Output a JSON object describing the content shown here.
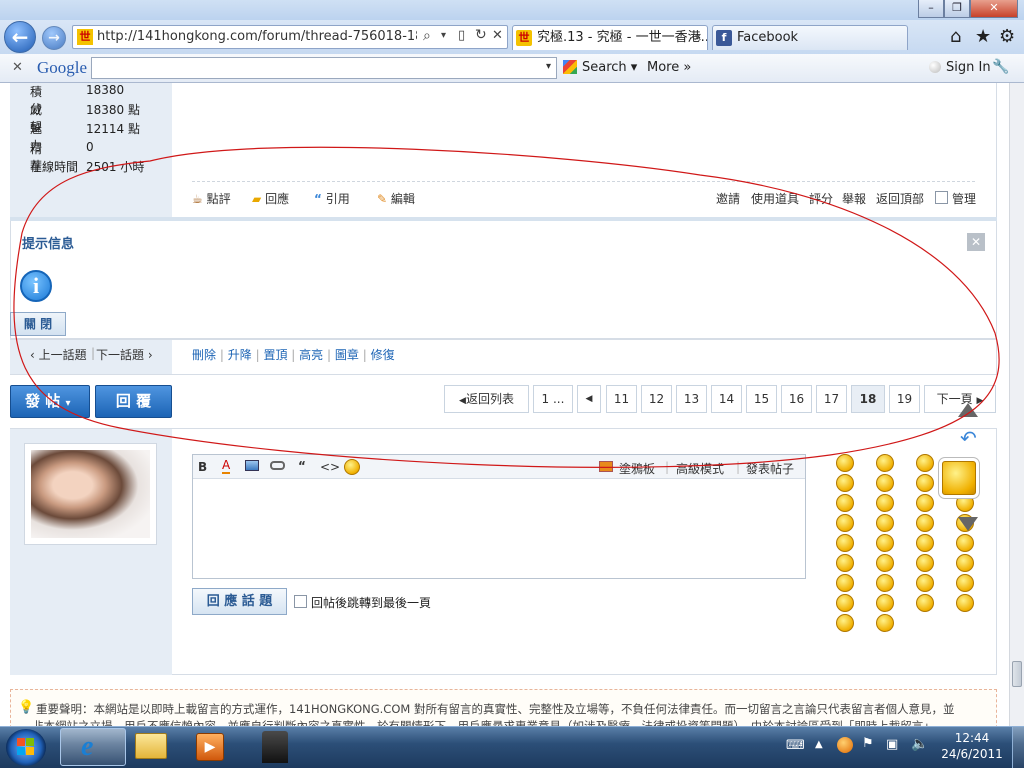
{
  "browser": {
    "url": "http://141hongkong.com/forum/thread-756018-18-1.htm",
    "tabs": [
      {
        "label": "究極.13 - 究極 - 一世一香港..."
      },
      {
        "label": "Facebook"
      }
    ],
    "google_toolbar": {
      "brand": "Google",
      "search_label": "Search",
      "more_label": "More",
      "signin_label": "Sign In"
    }
  },
  "profile": {
    "stats": [
      {
        "label": "積分",
        "value": "18380"
      },
      {
        "label": "威望",
        "value": "18380 點"
      },
      {
        "label": "魅力",
        "value": "12114 點"
      },
      {
        "label": "精華",
        "value": "0"
      },
      {
        "label": "在線時間",
        "value": "2501 小時"
      }
    ]
  },
  "post_actions": {
    "left": [
      "點評",
      "回應",
      "引用",
      "編輯"
    ],
    "right": [
      "邀請",
      "使用道具",
      "評分",
      "舉報",
      "返回頂部",
      "管理"
    ]
  },
  "notice": {
    "title": "提示信息",
    "close_label": "關 閉"
  },
  "thread_nav": {
    "prev": "上一話題",
    "next": "下一話題",
    "mod_actions": [
      "刪除",
      "升降",
      "置頂",
      "高亮",
      "圖章",
      "修復"
    ]
  },
  "buttons": {
    "new_post": "發 帖",
    "reply": "回 覆",
    "reply_topic": "回 應 話 題",
    "jump_last": "回帖後跳轉到最後一頁"
  },
  "pagination": {
    "back": "返回列表",
    "first": "1 ...",
    "pages": [
      "11",
      "12",
      "13",
      "14",
      "15",
      "16",
      "17",
      "18",
      "19"
    ],
    "current": "18",
    "next": "下一頁"
  },
  "editor": {
    "tools": [
      "B",
      "A",
      "“",
      "<>"
    ],
    "right_links": [
      "塗鴉板",
      "高級模式",
      "發表帖子"
    ]
  },
  "disclaimer": {
    "line1": "重要聲明：本網站是以即時上載留言的方式運作，141HONGKONG.COM 對所有留言的真實性、完整性及立場等，不負任何法律責任。而一切留言之言論只代表留言者個人意見，並",
    "line2": "非本網站之立場，用戶不應信賴內容，並應自行判斷內容之真實性。於有關情形下，用戶應尋求專業意見（如涉及醫療、法律或投資等問題）。由於本討論區受到「即時上載留言」"
  },
  "taskbar": {
    "time": "12:44",
    "date": "24/6/2011"
  },
  "colors": {
    "accent_blue": "#1c64b5",
    "annotation_red": "#d01818",
    "sidebar_bg": "#e6edf5"
  }
}
